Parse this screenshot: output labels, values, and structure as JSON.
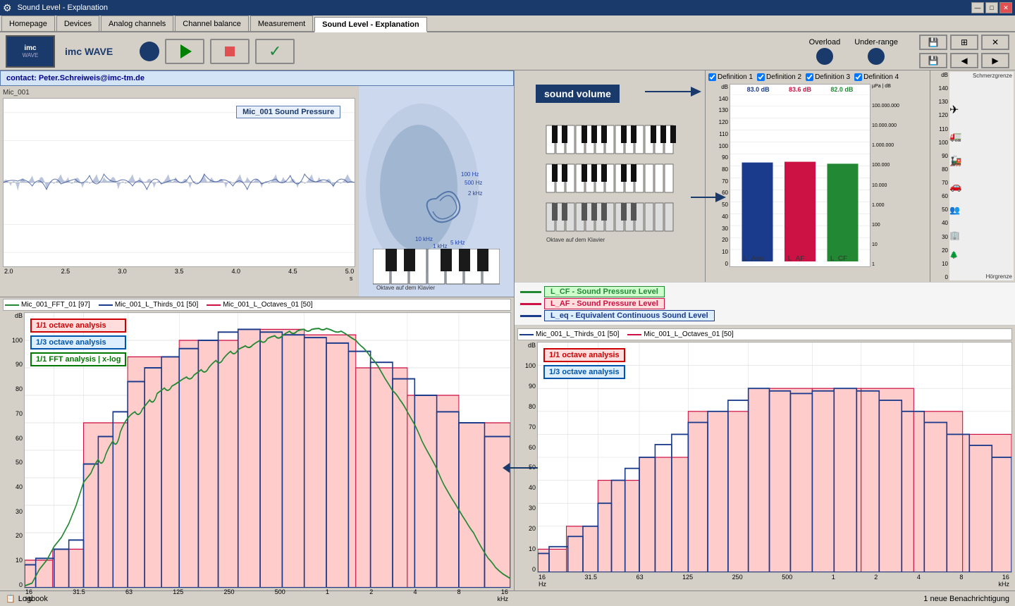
{
  "titleBar": {
    "title": "Sound Level - Explanation",
    "minBtn": "—",
    "maxBtn": "□",
    "closeBtn": "✕",
    "settingsIcon": "⚙"
  },
  "tabs": [
    {
      "label": "Homepage",
      "active": false
    },
    {
      "label": "Devices",
      "active": false
    },
    {
      "label": "Analog channels",
      "active": false
    },
    {
      "label": "Channel balance",
      "active": false
    },
    {
      "label": "Measurement",
      "active": false
    },
    {
      "label": "Sound Level - Explanation",
      "active": true
    }
  ],
  "toolbar": {
    "appName": "imc WAVE",
    "logoText": "imc",
    "logoSub": "WAVE",
    "overloadLabel": "Overload",
    "underRangeLabel": "Under-range"
  },
  "contact": "contact: Peter.Schreiweis@imc-tm.de",
  "definitions": [
    {
      "label": "Definition 1",
      "checked": true
    },
    {
      "label": "Definition 2",
      "checked": true
    },
    {
      "label": "Definition 3",
      "checked": true
    },
    {
      "label": "Definition 4",
      "checked": true
    }
  ],
  "waveform": {
    "channelLabel": "Mic_001",
    "titleLabel": "Mic_001 Sound Pressure",
    "yMin": -1.5,
    "yMax": 1.5,
    "yTicks": [
      "-1.5",
      "-1.0",
      "-0.5",
      "0",
      "0.5",
      "1.0",
      "1.5"
    ],
    "xTicks": [
      "2.0",
      "2.5",
      "3.0",
      "3.5",
      "4.0",
      "4.5",
      "5.0"
    ],
    "xLabel": "s"
  },
  "soundVolume": {
    "label": "sound volume"
  },
  "barChart": {
    "title": "dB",
    "values": [
      {
        "label": "L_Aeq",
        "value": 83.0,
        "color": "#1a3a8b",
        "dbLabel": "83.0 dB"
      },
      {
        "label": "L_AF",
        "value": 83.6,
        "color": "#cc1144",
        "dbLabel": "83.6 dB"
      },
      {
        "label": "L_CF",
        "value": 82.0,
        "color": "#228833",
        "dbLabel": "82.0 dB"
      }
    ],
    "yMax": 140,
    "yTicks": [
      "0",
      "10",
      "20",
      "30",
      "40",
      "50",
      "60",
      "70",
      "80",
      "90",
      "100",
      "110",
      "120",
      "130",
      "140"
    ],
    "rightTicks": [
      "0",
      "10",
      "20",
      "30",
      "40",
      "50",
      "60",
      "70",
      "80",
      "90",
      "100",
      "110",
      "120",
      "130",
      "140"
    ],
    "microPaLabel": "µPa",
    "dbRightLabel": "dB",
    "rightValues": [
      "100.000.000",
      "10.000.000",
      "1.000.000",
      "100.000",
      "10.000",
      "1.000",
      "100",
      "10",
      "1"
    ]
  },
  "soundIndicators": [
    {
      "label": "L_CF - Sound Pressure Level",
      "color": "green",
      "lineColor": "#228833"
    },
    {
      "label": "L_AF - Sound Pressure Level",
      "color": "red",
      "lineColor": "#cc1144"
    },
    {
      "label": "L_eq - Equivalent Continuous Sound Level",
      "color": "blue",
      "lineColor": "#1a3a8b"
    }
  ],
  "spectralChartLeft": {
    "legend": [
      {
        "label": "Mic_001_FFT_01 [97]",
        "color": "#228833",
        "style": "solid"
      },
      {
        "label": "Mic_001_L_Thirds_01 [50]",
        "color": "#1a3a8b",
        "style": "solid"
      },
      {
        "label": "Mic_001_L_Octaves_01 [50]",
        "color": "#cc1144",
        "style": "solid"
      }
    ],
    "labels": [
      {
        "text": "1/1 octave analysis",
        "type": "red"
      },
      {
        "text": "1/3 octave analysis",
        "type": "blue"
      },
      {
        "text": "1/1 FFT analysis | x-log",
        "type": "green"
      }
    ],
    "yLabel": "dB",
    "yMax": 100,
    "yTicks": [
      "0",
      "10",
      "20",
      "30",
      "40",
      "50",
      "60",
      "70",
      "80",
      "90",
      "100"
    ],
    "xTicksHz": [
      "16",
      "31.5",
      "63",
      "125",
      "250",
      "500"
    ],
    "xTicksKHz": [
      "1",
      "2",
      "4",
      "8",
      "16"
    ],
    "xLabelHz": "Hz",
    "xLabelKHz": "kHz"
  },
  "spectralChartRight": {
    "legend": [
      {
        "label": "Mic_001_L_Thirds_01 [50]",
        "color": "#1a3a8b",
        "style": "solid"
      },
      {
        "label": "Mic_001_L_Octaves_01 [50]",
        "color": "#cc1144",
        "style": "solid"
      }
    ],
    "labels": [
      {
        "text": "1/1 octave analysis",
        "type": "red"
      },
      {
        "text": "1/3 octave analysis",
        "type": "blue"
      }
    ],
    "yLabel": "dB",
    "yMax": 100,
    "yTicks": [
      "0",
      "10",
      "20",
      "30",
      "40",
      "50",
      "60",
      "70",
      "80",
      "90",
      "100"
    ],
    "xTicksHz": [
      "16",
      "31.5",
      "63",
      "125",
      "250",
      "500"
    ],
    "xTicksKHz": [
      "1",
      "2",
      "4",
      "8",
      "16"
    ],
    "xLabelHz": "Hz",
    "xLabelKHz": "kHz"
  },
  "statusBar": {
    "logbook": "Logbook",
    "notification": "1 neue Benachrichtigung"
  },
  "noiseImages": {
    "rightAxisLabels": [
      "Schmerzgrenze",
      "",
      "",
      "",
      "",
      "",
      "",
      "",
      "",
      "",
      "",
      "",
      "",
      "Hörgrenze"
    ]
  }
}
